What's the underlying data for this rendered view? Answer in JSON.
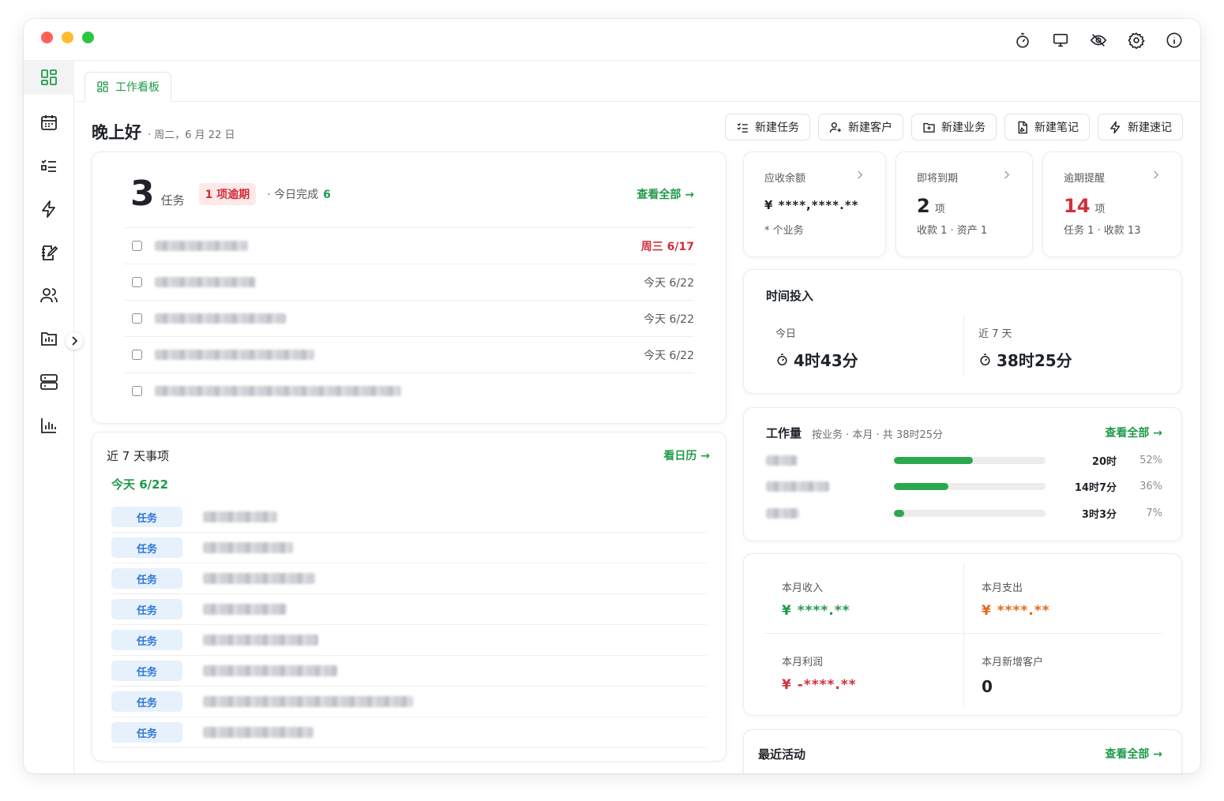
{
  "tab": {
    "label": "工作看板"
  },
  "header": {
    "greeting": "晚上好",
    "date": "· 周二，6 月 22 日"
  },
  "actions": [
    {
      "label": "新建任务",
      "icon": "task-list-icon"
    },
    {
      "label": "新建客户",
      "icon": "add-user-icon"
    },
    {
      "label": "新建业务",
      "icon": "folder-plus-icon"
    },
    {
      "label": "新建笔记",
      "icon": "note-icon"
    },
    {
      "label": "新建速记",
      "icon": "bolt-icon"
    }
  ],
  "tasks": {
    "count": "3",
    "unit": "任务",
    "overdue": "1 项逾期",
    "done_label": "· 今日完成",
    "done_count": "6",
    "view_all": "查看全部 →",
    "rows": [
      {
        "due": "周三 6/17",
        "overdue": true
      },
      {
        "due": "今天 6/22",
        "overdue": false
      },
      {
        "due": "今天 6/22",
        "overdue": false
      },
      {
        "due": "今天 6/22",
        "overdue": false
      },
      {
        "due": "",
        "overdue": false
      }
    ]
  },
  "week": {
    "title": "近 7 天事项",
    "link": "看日历 →",
    "today": "今天 6/22",
    "items": [
      "任务",
      "任务",
      "任务",
      "任务",
      "任务",
      "任务",
      "任务",
      "任务"
    ]
  },
  "stats": {
    "receivable": {
      "label": "应收余额",
      "value": "¥ ****,****.**",
      "sub": "* 个业务"
    },
    "due_soon": {
      "label": "即将到期",
      "value": "2",
      "unit": "项",
      "sub": "收款 1 · 资产 1"
    },
    "overdue": {
      "label": "逾期提醒",
      "value": "14",
      "unit": "项",
      "sub": "任务 1 · 收款 13"
    }
  },
  "time": {
    "title": "时间投入",
    "today_label": "今日",
    "today_value": "4时43分",
    "week_label": "近 7 天",
    "week_value": "38时25分"
  },
  "workload": {
    "title": "工作量",
    "subtitle": "按业务 · 本月 · 共 38时25分",
    "link": "查看全部 →",
    "rows": [
      {
        "hours": "20时",
        "pct": "52%",
        "value": 0.52
      },
      {
        "hours": "14时7分",
        "pct": "36%",
        "value": 0.36
      },
      {
        "hours": "3时3分",
        "pct": "7%",
        "value": 0.07
      }
    ]
  },
  "finance": {
    "income_label": "本月收入",
    "income_value": "¥ ****.**",
    "expense_label": "本月支出",
    "expense_value": "¥ ****.**",
    "profit_label": "本月利润",
    "profit_value": "¥ -****.**",
    "new_clients_label": "本月新增客户",
    "new_clients_value": "0"
  },
  "activity": {
    "title": "最近活动",
    "link": "查看全部 →"
  },
  "colors": {
    "accent": "#1f9a4a",
    "danger": "#d12f3a",
    "info": "#2f78d8",
    "warn": "#e2681b"
  }
}
